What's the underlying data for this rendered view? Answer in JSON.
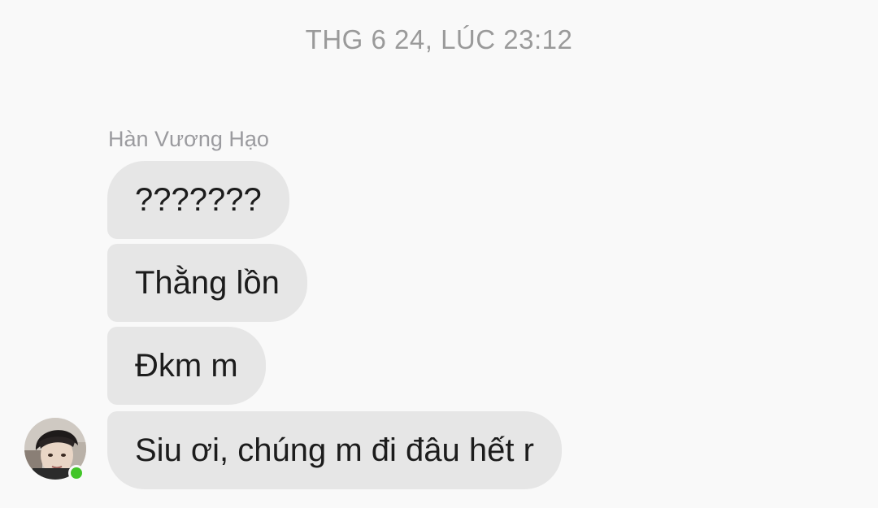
{
  "conversation": {
    "timestamp": "THG 6 24, LÚC 23:12",
    "sender": {
      "name": "Hàn Vương Hạo",
      "online": true,
      "online_color": "#42c529",
      "avatar_icon": "user-avatar-photo"
    },
    "messages": [
      {
        "text": "???????"
      },
      {
        "text": "Thằng lồn"
      },
      {
        "text": "Đkm m"
      },
      {
        "text": "Siu ơi, chúng m đi đâu hết r"
      }
    ]
  },
  "colors": {
    "background": "#f9f9f9",
    "bubble": "#e6e6e6",
    "text": "#1c1c1c",
    "timestamp": "#9a9a9a"
  }
}
